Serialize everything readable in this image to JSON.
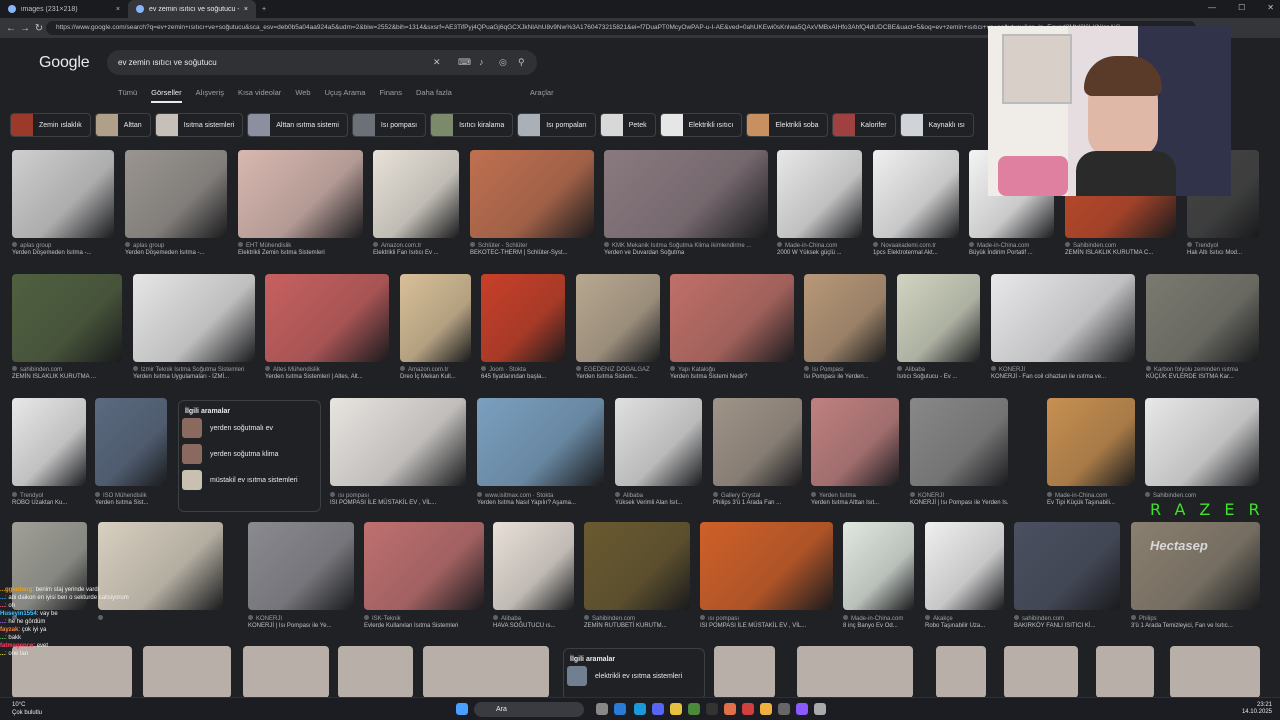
{
  "browser": {
    "tabs": [
      {
        "label": "images (231×218)"
      },
      {
        "label": "ev zemin ısıtıcı ve soğutucu - Go..."
      }
    ],
    "new_tab": "+",
    "url": "https://www.google.com/search?q=ev+zemin+ısıtıcı+ve+soğutucu&sca_esv=deb0b5a04aa924a5&udm=2&biw=2552&bih=1314&sxsrf=AE3TifPyj4QPuaGj6qGCXJkNlAhU8v9Nw%3A1760473215821&ei=f7DuaPT0McyOwPAP-u-I-AE&ved=0ahUKEwi0sKnlwa5QAxVMBxAIHfo3AhfQ4dUDCBE&uact=5&oq=ev+zemin+ısıtıcı+ve+soğutucu&gs_lp=Egxnd3Mtd2l6LXNlcnAiG"
  },
  "search": {
    "logo": "Google",
    "query": "ev zemin ısıtıcı ve soğutucu",
    "tabs": [
      "Tümü",
      "Görseller",
      "Alışveriş",
      "Kısa videolar",
      "Web",
      "Uçuş Arama",
      "Finans",
      "Daha fazla"
    ],
    "active_tab": "Görseller",
    "tools": "Araçlar"
  },
  "chips": [
    {
      "label": "Zemin ıslaklık",
      "color": "#9b3a2a"
    },
    {
      "label": "Alttan",
      "color": "#b0a08a"
    },
    {
      "label": "Isıtma sistemleri",
      "color": "#c6c0b8"
    },
    {
      "label": "Alttan ısıtma sistemi",
      "color": "#8c8fa0"
    },
    {
      "label": "Isı pompası",
      "color": "#6c7078"
    },
    {
      "label": "Isıtıcı kiralama",
      "color": "#7a8a6a"
    },
    {
      "label": "Isı pompaları",
      "color": "#aab0b8"
    },
    {
      "label": "Petek",
      "color": "#d8d8d8"
    },
    {
      "label": "Elektrikli ısıtıcı",
      "color": "#e6e6e6"
    },
    {
      "label": "Elektrikli soba",
      "color": "#c89060"
    },
    {
      "label": "Kalorifer",
      "color": "#a04040"
    },
    {
      "label": "Kaynaklı ısı",
      "color": "#d0d4d8"
    }
  ],
  "row1": [
    {
      "source": "aplas group",
      "title": "Yerden Döşemeden Isıtma -...",
      "color": "#cfcfcf"
    },
    {
      "source": "aplas group",
      "title": "Yerden Döşemeden Isıtma -...",
      "color": "#9a9590"
    },
    {
      "source": "EHT Mühendislik",
      "title": "Elektrikli Zemin Isıtma Sistemleri",
      "color": "#d8b8b0"
    },
    {
      "source": "Amazon.com.tr",
      "title": "Elektrikli Fan Isıtıcı Ev ...",
      "color": "#e8e2d8"
    },
    {
      "source": "Schlüter - Schlüter",
      "title": "BEKOTEC-THERM | Schlüter-Syst...",
      "color": "#c07050"
    },
    {
      "source": "KMK Mekanik Isıtma Soğutma Klima ikimlendirme ...",
      "title": "Yerden ve Duvardan Soğutma",
      "color": "#8a7a80"
    },
    {
      "source": "Made-in-China.com",
      "title": "2000 W Yüksek güçlü ...",
      "color": "#e8e8e8"
    },
    {
      "source": "Novaakademi.com.tr",
      "title": "1pcs Elektrotermal Akt...",
      "color": "#f0f0f0"
    },
    {
      "source": "Made-in-China.com",
      "title": "Büyük İndirim Portatif ...",
      "color": "#f4f4f4"
    },
    {
      "source": "Sahibinden.com",
      "title": "ZEMİN ISLAKLIK KURUTMA C...",
      "color": "#c04a2a"
    },
    {
      "source": "Trendyol",
      "title": "Halı Altı Isıtıcı Mod...",
      "color": "#444444"
    }
  ],
  "row2": [
    {
      "source": "sahibinden.com",
      "title": "ZEMİN ISLAKLIK KURUTMA ...",
      "color": "#506040"
    },
    {
      "source": "İzmir Teknik Isıtma Soğutma Sistemleri",
      "title": "Yerden Isıtma Uygulamaları - İZMİ...",
      "color": "#e6e6e6"
    },
    {
      "source": "Altes Mühendislik",
      "title": "Yerden Isıtma Sistemleri | Altes, Alt...",
      "color": "#c86060"
    },
    {
      "source": "Amazon.com.tr",
      "title": "Dreo İç Mekan Kull...",
      "color": "#d8c098"
    },
    {
      "source": "Joom · Stokta",
      "title": "645 fiyatlarından başla...",
      "color": "#c84028"
    },
    {
      "source": "EGEDENİZ DOĞALGAZ",
      "title": "Yerden Isıtma Sistem...",
      "color": "#b8a890"
    },
    {
      "source": "Yapı Kataloğu",
      "title": "Yerden Isıtma Sistemi Nedir?",
      "color": "#c07068"
    },
    {
      "source": "Isı Pompası",
      "title": "Isı Pompası ile Yerden...",
      "color": "#b89878"
    },
    {
      "source": "Alibaba",
      "title": "Isıtıcı Soğutucu - Ev ...",
      "color": "#d0d4c0"
    },
    {
      "source": "KONERJİ",
      "title": "KONERJİ - Fan coil cihazları ile ısıtma ve...",
      "color": "#e8e8ea"
    },
    {
      "source": "Karbon folyolu zeminden ısıtma",
      "title": "KÜÇÜK EVLERDE ISITMA Kar...",
      "color": "#7a7a70"
    }
  ],
  "related": {
    "title": "İlgili aramalar",
    "items": [
      "yerden soğutmalı ev",
      "yerden soğutma klima",
      "müstakil ev ısıtma sistemleri"
    ]
  },
  "row3": [
    {
      "source": "Trendyol",
      "title": "ROBO Uzaktan Ku...",
      "color": "#e8e8e8"
    },
    {
      "source": "ISO Mühendislik",
      "title": "Yerden Isıtma Sist...",
      "color": "#5a6a80"
    },
    {
      "source": "ısı pompası",
      "title": "ISI POMPASI İLE MÜSTAKİL EV , VİL...",
      "color": "#e8e4e0"
    },
    {
      "source": "www.isitmax.com · Stokta",
      "title": "Yerden Isıtma Nasıl Yapılır? Aşama...",
      "color": "#7aa0c0"
    },
    {
      "source": "Alibaba",
      "title": "Yüksek Verimli Alan Isıt...",
      "color": "#e0e0e0"
    },
    {
      "source": "Gallery Crystal",
      "title": "Philips 3'ü 1 Arada Fan ...",
      "color": "#a09488"
    },
    {
      "source": "Yerden Isıtma",
      "title": "Yerden Isıtma Alttan Isıt...",
      "color": "#c08080"
    },
    {
      "source": "KONERJİ",
      "title": "KONERJİ | Isı Pompası ile Yerden Is...",
      "color": "#888888"
    },
    {
      "source": "Made-in-China.com",
      "title": "Ev Tipi Küçük Taşınabili...",
      "color": "#c89050"
    },
    {
      "source": "Sahibinden.com",
      "title": "",
      "color": "#e8e8e8"
    }
  ],
  "row4": [
    {
      "source": "",
      "title": "",
      "color": "#a0a098"
    },
    {
      "source": "",
      "title": "",
      "color": "#d8d0c0"
    },
    {
      "source": "KONERJİ",
      "title": "KONERJİ | Isı Pompası ile Ye...",
      "color": "#8a8a90"
    },
    {
      "source": "ISK-Teknik",
      "title": "Evlerde Kullanılan Isıtma Sistemleri",
      "color": "#c07070"
    },
    {
      "source": "Alibaba",
      "title": "HAVA SOĞUTUCU ıs...",
      "color": "#e8e0d8"
    },
    {
      "source": "Sahibinden.com",
      "title": "ZEMİN RUTUBETİ KURUTM...",
      "color": "#6a5a30"
    },
    {
      "source": "ısı pompası",
      "title": "ISI POMPASI İLE MÜSTAKİL EV , VİL...",
      "color": "#d06028"
    },
    {
      "source": "Made-in-China.com",
      "title": "8 inç Banyo Ev Od...",
      "color": "#e0e8e0"
    },
    {
      "source": "Akakçe",
      "title": "Robo Taşınabilir Uza...",
      "color": "#f0f0f0"
    },
    {
      "source": "sahibinden.com",
      "title": "BAKIRKÖY FANLI ISITICI Kİ...",
      "color": "#4a5060"
    },
    {
      "source": "Philips",
      "title": "3'ü 1 Arada Temizleyici, Fan ve Isıtıc...",
      "color": "#8a8070"
    }
  ],
  "row5_related": {
    "title": "İlgili aramalar",
    "item": "elektrikli ev ısıtma sistemleri"
  },
  "stream": {
    "brand": "RAZER",
    "overlay_logo": "Hectasep",
    "chat": [
      {
        "user": "...ggenberg",
        "text": "benim staj yerinde vardı",
        "color": "#e8a020"
      },
      {
        "user": "...",
        "text": "abi daikon en iyisi ben o sekturde calisiyorum abi",
        "color": "#40a0ff"
      },
      {
        "user": "...",
        "text": "oh",
        "color": "#ff6080"
      },
      {
        "user": "Huseyin1554",
        "text": "vay be",
        "color": "#40c0ff"
      },
      {
        "user": "...",
        "text": "he he gördüm",
        "color": "#a060ff"
      },
      {
        "user": "fayzak",
        "text": "çok iyi ya",
        "color": "#ff8040"
      },
      {
        "user": "...",
        "text": "bakk",
        "color": "#60d060"
      },
      {
        "user": "fatmagence",
        "text": "evet",
        "color": "#ff4060"
      },
      {
        "user": "...",
        "text": "one lan",
        "color": "#e0e040"
      }
    ]
  },
  "taskbar": {
    "weather_temp": "10°C",
    "weather_desc": "Çok bulutlu",
    "search_label": "Ara",
    "time": "23:21",
    "date": "14.10.2025"
  }
}
